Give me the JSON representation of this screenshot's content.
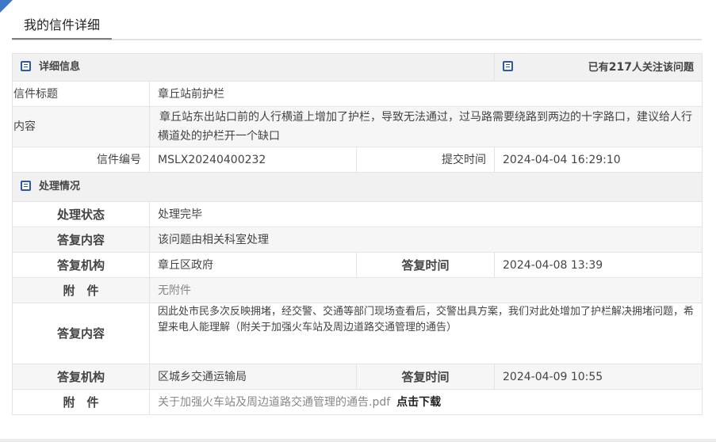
{
  "tab": {
    "title": "我的信件详细"
  },
  "detail": {
    "section_title": "详细信息",
    "follow_prefix": "已有",
    "follow_count": "217",
    "follow_suffix": "人关注该问题",
    "title_label": "信件标题",
    "title_value": "章丘站前护栏",
    "content_label": "内容",
    "content_value": "章丘站东出站口前的人行横道上增加了护栏，导致无法通过，过马路需要绕路到两边的十字路口，建议给人行横道处的护栏开一个缺口",
    "number_label": "信件编号",
    "number_value": "MSLX20240400232",
    "submit_label": "提交时间",
    "submit_value": "2024-04-04 16:29:10"
  },
  "processing": {
    "section_title": "处理情况",
    "status_label": "处理状态",
    "status_value": "处理完毕",
    "reply1": {
      "content_label": "答复内容",
      "content_value": "该问题由相关科室处理",
      "org_label": "答复机构",
      "org_value": "章丘区政府",
      "time_label": "答复时间",
      "time_value": "2024-04-08 13:39",
      "attach_label": "附　件",
      "attach_value": "无附件"
    },
    "reply2": {
      "content_label": "答复内容",
      "content_value": "因此处市民多次反映拥堵，经交警、交通等部门现场查看后，交警出具方案，我们对此处增加了护栏解决拥堵问题，希望来电人能理解（附关于加强火车站及周边道路交通管理的通告）",
      "org_label": "答复机构",
      "org_value": "区城乡交通运输局",
      "time_label": "答复时间",
      "time_value": "2024-04-09 10:55",
      "attach_label": "附　件",
      "attach_file": "关于加强火车站及周边道路交通管理的通告.pdf",
      "download_label": "点击下载"
    }
  }
}
